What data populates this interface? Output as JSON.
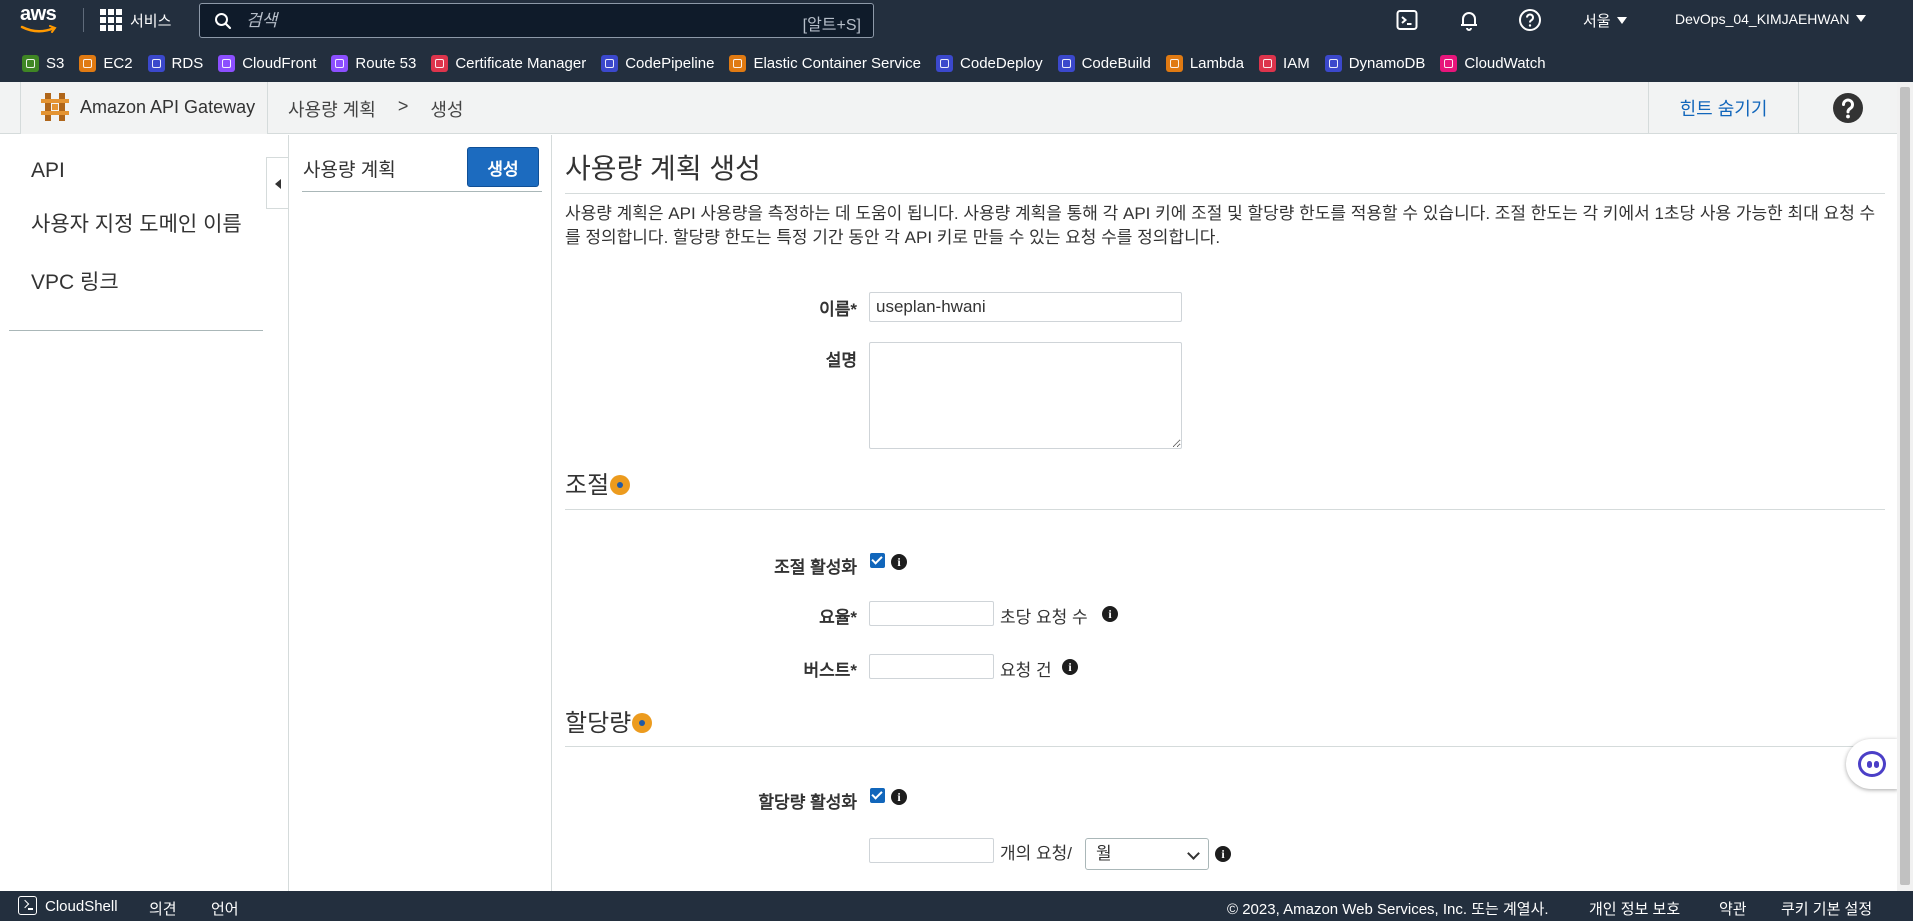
{
  "topnav": {
    "logo_text": "aws",
    "services_label": "서비스",
    "search_placeholder": "검색",
    "search_shortcut": "[알트+S]",
    "region": "서울",
    "account": "DevOps_04_KIMJAEHWAN",
    "favorites": [
      {
        "label": "S3",
        "color": "#3f8624"
      },
      {
        "label": "EC2",
        "color": "#e07a12"
      },
      {
        "label": "RDS",
        "color": "#3b48cc"
      },
      {
        "label": "CloudFront",
        "color": "#8c4fff"
      },
      {
        "label": "Route 53",
        "color": "#8c4fff"
      },
      {
        "label": "Certificate Manager",
        "color": "#dd344c"
      },
      {
        "label": "CodePipeline",
        "color": "#3b48cc"
      },
      {
        "label": "Elastic Container Service",
        "color": "#e07a12"
      },
      {
        "label": "CodeDeploy",
        "color": "#3b48cc"
      },
      {
        "label": "CodeBuild",
        "color": "#3b48cc"
      },
      {
        "label": "Lambda",
        "color": "#e07a12"
      },
      {
        "label": "IAM",
        "color": "#dd344c"
      },
      {
        "label": "DynamoDB",
        "color": "#3b48cc"
      },
      {
        "label": "CloudWatch",
        "color": "#e7157b"
      }
    ]
  },
  "header": {
    "product_name": "Amazon API Gateway",
    "breadcrumb": [
      "사용량 계획",
      ">",
      "생성"
    ],
    "hint_toggle": "힌트 숨기기",
    "help_icon": "question-circle-icon"
  },
  "sidebar": {
    "items": [
      {
        "label": "API"
      },
      {
        "label": "사용자 지정 도메인 이름"
      },
      {
        "label": "VPC 링크"
      }
    ]
  },
  "plan_panel": {
    "title": "사용량 계획",
    "create_button": "생성"
  },
  "main": {
    "title": "사용량 계획 생성",
    "description": "사용량 계획은 API 사용량을 측정하는 데 도움이 됩니다. 사용량 계획을 통해 각 API 키에 조절 및 할당량 한도를 적용할 수 있습니다. 조절 한도는 각 키에서 1초당 사용 가능한 최대 요청 수를 정의합니다. 할당량 한도는 특정 기간 동안 각 API 키로 만들 수 있는 요청 수를 정의합니다.",
    "name_label": "이름*",
    "name_value": "useplan-hwani",
    "desc_label": "설명",
    "desc_value": "",
    "throttle": {
      "heading": "조절",
      "enable_label": "조절 활성화",
      "enabled": true,
      "rate_label": "요율*",
      "rate_value": "",
      "rate_unit": "초당 요청 수",
      "burst_label": "버스트*",
      "burst_value": "",
      "burst_unit": "요청 건"
    },
    "quota": {
      "heading": "할당량",
      "enable_label": "할당량 활성화",
      "enabled": true,
      "requests_value": "",
      "requests_unit": "개의 요청/",
      "period_selected": "월"
    }
  },
  "footer": {
    "cloudshell": "CloudShell",
    "feedback": "의견",
    "language": "언어",
    "copyright": "© 2023, Amazon Web Services, Inc. 또는 계열사.",
    "privacy": "개인 정보 보호",
    "terms": "약관",
    "cookies": "쿠키 기본 설정"
  }
}
